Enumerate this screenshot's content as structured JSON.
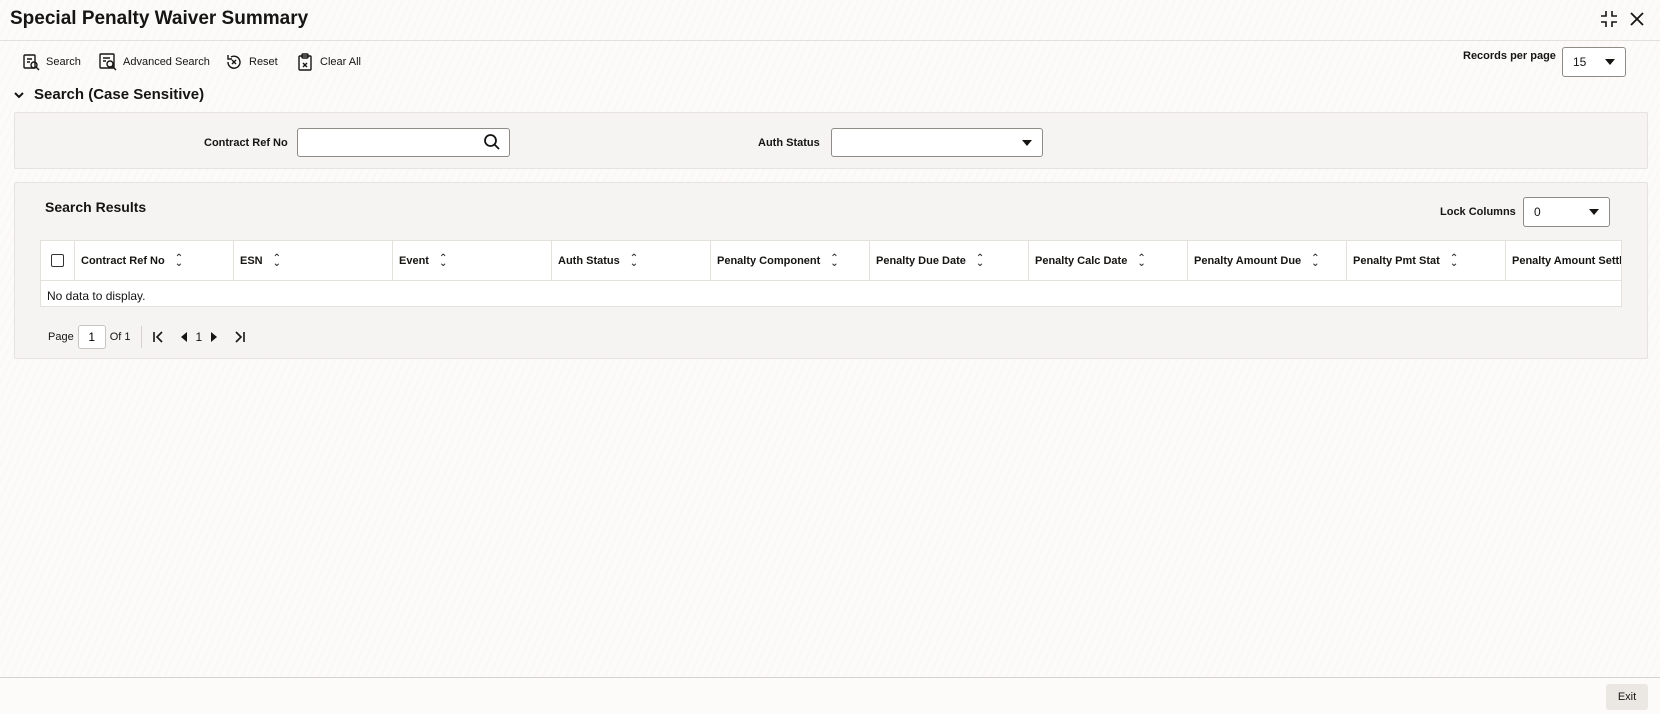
{
  "window": {
    "title": "Special Penalty Waiver Summary"
  },
  "toolbar": {
    "search_label": "Search",
    "advanced_search_label": "Advanced Search",
    "reset_label": "Reset",
    "clear_all_label": "Clear All"
  },
  "records_per_page": {
    "label": "Records per page",
    "value": "15"
  },
  "search_section": {
    "title": "Search (Case Sensitive)",
    "contract_ref_label": "Contract Ref No",
    "contract_ref_value": "",
    "auth_status_label": "Auth Status",
    "auth_status_value": ""
  },
  "results": {
    "title": "Search Results",
    "lock_columns_label": "Lock Columns",
    "lock_columns_value": "0",
    "columns": [
      "Contract Ref No",
      "ESN",
      "Event",
      "Auth Status",
      "Penalty Component",
      "Penalty Due Date",
      "Penalty Calc Date",
      "Penalty Amount Due",
      "Penalty Pmt Stat",
      "Penalty Amount Settled"
    ],
    "empty_message": "No data to display."
  },
  "pagination": {
    "page_label": "Page",
    "page_value": "1",
    "of_label": "Of 1",
    "current_page": "1"
  },
  "footer": {
    "exit_label": "Exit"
  },
  "icons": {
    "minimize": "collapse-icon",
    "close": "close-icon",
    "search": "search-icon"
  }
}
